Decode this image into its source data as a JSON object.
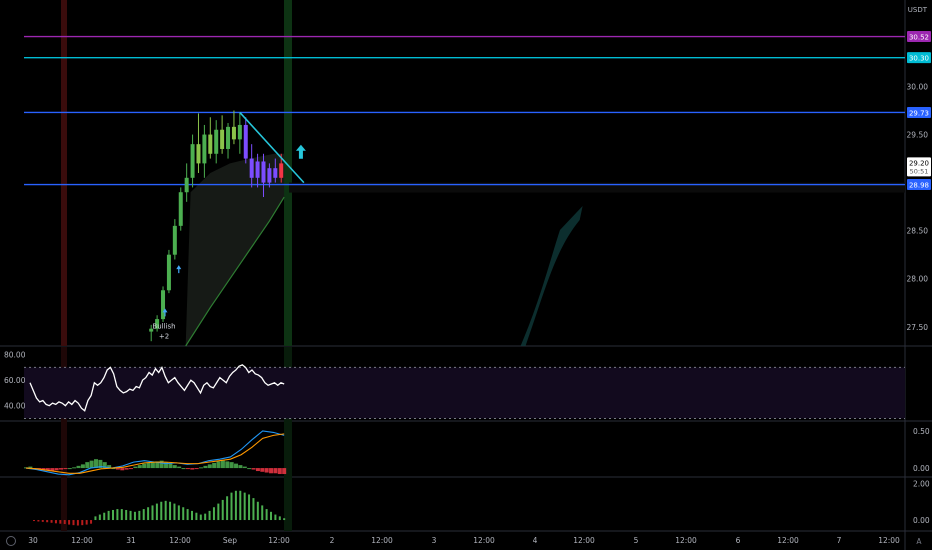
{
  "chart_data": [
    {
      "type": "candlestick",
      "pane": "price",
      "quote_currency": "USDT",
      "y_ticks": [
        27.5,
        28.0,
        28.5,
        29.0,
        29.5,
        30.0
      ],
      "ylim": [
        27.3,
        30.9
      ],
      "x_ticks": [
        "30",
        "12:00",
        "31",
        "12:00",
        "Sep",
        "12:00",
        "2",
        "12:00",
        "3",
        "12:00",
        "4",
        "12:00",
        "5",
        "12:00",
        "6",
        "12:00",
        "7",
        "12:00"
      ],
      "horizontal_levels": [
        {
          "value": 30.52,
          "label": "30.52",
          "color": "#9c27b0"
        },
        {
          "value": 30.3,
          "label": "30.30",
          "color": "#00bcd4"
        },
        {
          "value": 29.73,
          "label": "29.73",
          "color": "#2962ff"
        },
        {
          "value": 28.98,
          "label": "28.98",
          "color": "#2962ff"
        }
      ],
      "last_price": {
        "value": "29.20",
        "countdown": "50:51"
      },
      "trendline": {
        "from": {
          "t": 2.1,
          "v": 29.73
        },
        "to": {
          "t": 2.75,
          "v": 29.0
        },
        "color": "#26c6da"
      },
      "annotation": {
        "text": "Bullish",
        "sub": "+2"
      },
      "candles": [
        {
          "t": 1.2,
          "o": 27.45,
          "h": 27.52,
          "l": 27.35,
          "c": 27.48
        },
        {
          "t": 1.26,
          "o": 27.48,
          "h": 27.62,
          "l": 27.45,
          "c": 27.58
        },
        {
          "t": 1.32,
          "o": 27.58,
          "h": 27.92,
          "l": 27.55,
          "c": 27.88
        },
        {
          "t": 1.38,
          "o": 27.88,
          "h": 28.3,
          "l": 27.85,
          "c": 28.25
        },
        {
          "t": 1.44,
          "o": 28.25,
          "h": 28.62,
          "l": 28.2,
          "c": 28.55
        },
        {
          "t": 1.5,
          "o": 28.55,
          "h": 28.95,
          "l": 28.5,
          "c": 28.9
        },
        {
          "t": 1.56,
          "o": 28.9,
          "h": 29.2,
          "l": 28.8,
          "c": 29.05
        },
        {
          "t": 1.62,
          "o": 29.05,
          "h": 29.5,
          "l": 28.95,
          "c": 29.4
        },
        {
          "t": 1.68,
          "o": 29.4,
          "h": 29.72,
          "l": 29.1,
          "c": 29.2
        },
        {
          "t": 1.74,
          "o": 29.2,
          "h": 29.6,
          "l": 29.05,
          "c": 29.5
        },
        {
          "t": 1.8,
          "o": 29.5,
          "h": 29.68,
          "l": 29.25,
          "c": 29.3
        },
        {
          "t": 1.86,
          "o": 29.3,
          "h": 29.65,
          "l": 29.2,
          "c": 29.55
        },
        {
          "t": 1.92,
          "o": 29.55,
          "h": 29.7,
          "l": 29.3,
          "c": 29.35
        },
        {
          "t": 1.98,
          "o": 29.35,
          "h": 29.62,
          "l": 29.25,
          "c": 29.58
        },
        {
          "t": 2.04,
          "o": 29.58,
          "h": 29.75,
          "l": 29.4,
          "c": 29.45
        },
        {
          "t": 2.1,
          "o": 29.45,
          "h": 29.73,
          "l": 29.3,
          "c": 29.6
        },
        {
          "t": 2.16,
          "o": 29.6,
          "h": 29.68,
          "l": 29.2,
          "c": 29.25
        },
        {
          "t": 2.22,
          "o": 29.25,
          "h": 29.4,
          "l": 28.95,
          "c": 29.05
        },
        {
          "t": 2.28,
          "o": 29.05,
          "h": 29.3,
          "l": 28.95,
          "c": 29.22
        },
        {
          "t": 2.34,
          "o": 29.22,
          "h": 29.3,
          "l": 28.85,
          "c": 29.0
        },
        {
          "t": 2.4,
          "o": 29.0,
          "h": 29.2,
          "l": 28.95,
          "c": 29.15
        },
        {
          "t": 2.46,
          "o": 29.15,
          "h": 29.25,
          "l": 29.0,
          "c": 29.05
        },
        {
          "t": 2.52,
          "o": 29.05,
          "h": 29.3,
          "l": 29.0,
          "c": 29.2
        }
      ],
      "moving_average": [
        {
          "t": 1.55,
          "v": 27.3
        },
        {
          "t": 1.8,
          "v": 27.7
        },
        {
          "t": 2.0,
          "v": 28.0
        },
        {
          "t": 2.2,
          "v": 28.3
        },
        {
          "t": 2.4,
          "v": 28.6
        },
        {
          "t": 2.55,
          "v": 28.85
        }
      ]
    },
    {
      "type": "line",
      "pane": "rsi",
      "y_ticks": [
        40.0,
        60.0,
        80.0
      ],
      "ylim": [
        28,
        86
      ],
      "bands": [
        70,
        30
      ],
      "values": [
        58,
        52,
        46,
        43,
        44,
        41,
        40,
        42,
        41,
        43,
        42,
        40,
        43,
        41,
        44,
        42,
        38,
        36,
        44,
        48,
        58,
        56,
        58,
        62,
        68,
        70,
        65,
        55,
        52,
        50,
        51,
        53,
        52,
        55,
        54,
        60,
        62,
        66,
        64,
        69,
        66,
        70,
        63,
        58,
        60,
        62,
        58,
        55,
        52,
        56,
        60,
        58,
        54,
        50,
        56,
        58,
        55,
        54,
        58,
        62,
        60,
        58,
        63,
        66,
        68,
        71,
        72,
        70,
        66,
        68,
        65,
        64,
        62,
        58,
        56,
        57,
        58,
        56,
        58,
        57
      ]
    },
    {
      "type": "macd",
      "pane": "macd",
      "y_ticks": [
        0.0,
        0.5
      ],
      "ylim": [
        -0.12,
        0.62
      ],
      "histogram": [
        0.01,
        0.02,
        0.0,
        -0.01,
        -0.02,
        -0.03,
        -0.04,
        -0.03,
        -0.02,
        -0.01,
        0.0,
        0.01,
        0.03,
        0.05,
        0.08,
        0.1,
        0.12,
        0.11,
        0.08,
        0.04,
        0.0,
        -0.02,
        -0.03,
        -0.02,
        -0.01,
        0.02,
        0.04,
        0.06,
        0.07,
        0.08,
        0.09,
        0.1,
        0.08,
        0.06,
        0.04,
        0.02,
        0.0,
        -0.01,
        -0.02,
        -0.01,
        0.01,
        0.03,
        0.05,
        0.07,
        0.09,
        0.1,
        0.09,
        0.08,
        0.06,
        0.04,
        0.02,
        0.0,
        -0.02,
        -0.04,
        -0.05,
        -0.06,
        -0.07,
        -0.07,
        -0.08,
        -0.08
      ],
      "macd": [
        0.0,
        -0.02,
        -0.05,
        -0.08,
        -0.09,
        -0.06,
        0.0,
        0.02,
        0.0,
        0.03,
        0.08,
        0.1,
        0.08,
        0.06,
        0.07,
        0.05,
        0.06,
        0.1,
        0.12,
        0.15,
        0.25,
        0.38,
        0.5,
        0.48,
        0.44
      ],
      "signal": [
        0.0,
        -0.01,
        -0.03,
        -0.05,
        -0.07,
        -0.07,
        -0.04,
        -0.01,
        0.0,
        0.01,
        0.04,
        0.07,
        0.08,
        0.08,
        0.07,
        0.06,
        0.06,
        0.08,
        0.1,
        0.12,
        0.18,
        0.28,
        0.4,
        0.44,
        0.46
      ]
    },
    {
      "type": "histogram",
      "pane": "momentum",
      "y_ticks": [
        0.0,
        2.0
      ],
      "ylim": [
        -0.6,
        2.3
      ],
      "values": [
        -0.05,
        -0.08,
        -0.1,
        -0.12,
        -0.15,
        -0.18,
        -0.2,
        -0.22,
        -0.25,
        -0.28,
        -0.3,
        -0.28,
        -0.25,
        -0.2,
        0.2,
        0.3,
        0.4,
        0.5,
        0.55,
        0.6,
        0.6,
        0.55,
        0.5,
        0.45,
        0.5,
        0.6,
        0.7,
        0.8,
        0.9,
        1.0,
        1.05,
        1.0,
        0.9,
        0.8,
        0.7,
        0.6,
        0.5,
        0.4,
        0.3,
        0.35,
        0.5,
        0.7,
        0.9,
        1.1,
        1.3,
        1.5,
        1.6,
        1.6,
        1.5,
        1.4,
        1.2,
        1.0,
        0.8,
        0.6,
        0.45,
        0.3,
        0.2,
        0.1
      ]
    }
  ]
}
